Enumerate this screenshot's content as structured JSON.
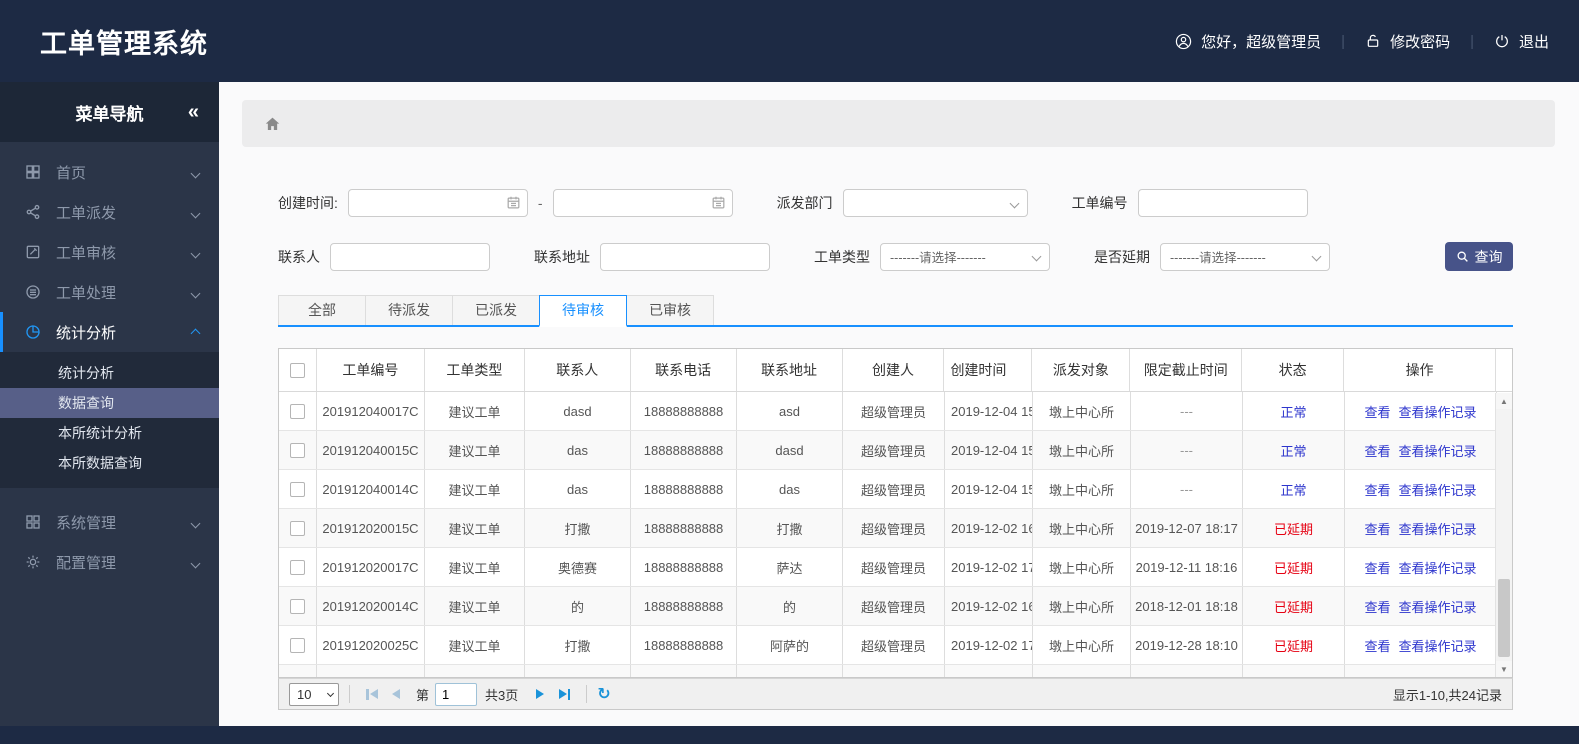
{
  "app": {
    "title": "工单管理系统"
  },
  "topbar": {
    "greeting": "您好，超级管理员",
    "change_password": "修改密码",
    "logout": "退出",
    "separator": "|"
  },
  "sidebar": {
    "title": "菜单导航",
    "collapse_glyph": "«",
    "items": [
      {
        "label": "首页",
        "icon": "grid-icon"
      },
      {
        "label": "工单派发",
        "icon": "share-icon"
      },
      {
        "label": "工单审核",
        "icon": "edit-icon"
      },
      {
        "label": "工单处理",
        "icon": "process-icon"
      },
      {
        "label": "统计分析",
        "icon": "pie-chart-icon"
      },
      {
        "label": "系统管理",
        "icon": "system-icon"
      },
      {
        "label": "配置管理",
        "icon": "gear-icon"
      }
    ],
    "submenu": [
      {
        "label": "统计分析"
      },
      {
        "label": "数据查询"
      },
      {
        "label": "本所统计分析"
      },
      {
        "label": "本所数据查询"
      }
    ],
    "active_item": "统计分析",
    "selected_submenu": "数据查询"
  },
  "filters": {
    "created_time_label": "创建时间:",
    "range_separator": "-",
    "dispatch_dept_label": "派发部门",
    "order_no_label": "工单编号",
    "contact_label": "联系人",
    "address_label": "联系地址",
    "order_type_label": "工单类型",
    "delay_label": "是否延期",
    "select_placeholder": "-------请选择-------",
    "search_button": "查询"
  },
  "tabs": [
    {
      "label": "全部"
    },
    {
      "label": "待派发"
    },
    {
      "label": "已派发"
    },
    {
      "label": "待审核"
    },
    {
      "label": "已审核"
    }
  ],
  "active_tab": "待审核",
  "table": {
    "columns": [
      "工单编号",
      "工单类型",
      "联系人",
      "联系电话",
      "联系地址",
      "创建人",
      "创建时间",
      "派发对象",
      "限定截止时间",
      "状态",
      "操作"
    ],
    "actions": {
      "view": "查看",
      "view_log": "查看操作记录"
    },
    "rows": [
      {
        "order_no": "201912040017C",
        "type": "建议工单",
        "contact": "dasd",
        "phone": "18888888888",
        "address": "asd",
        "creator": "超级管理员",
        "created": "2019-12-04 15",
        "target": "墩上中心所",
        "deadline": "---",
        "status": "正常",
        "status_class": "st-normal"
      },
      {
        "order_no": "201912040015C",
        "type": "建议工单",
        "contact": "das",
        "phone": "18888888888",
        "address": "dasd",
        "creator": "超级管理员",
        "created": "2019-12-04 15",
        "target": "墩上中心所",
        "deadline": "---",
        "status": "正常",
        "status_class": "st-normal"
      },
      {
        "order_no": "201912040014C",
        "type": "建议工单",
        "contact": "das",
        "phone": "18888888888",
        "address": "das",
        "creator": "超级管理员",
        "created": "2019-12-04 15",
        "target": "墩上中心所",
        "deadline": "---",
        "status": "正常",
        "status_class": "st-normal"
      },
      {
        "order_no": "201912020015C",
        "type": "建议工单",
        "contact": "打撒",
        "phone": "18888888888",
        "address": "打撒",
        "creator": "超级管理员",
        "created": "2019-12-02 16",
        "target": "墩上中心所",
        "deadline": "2019-12-07 18:17",
        "status": "已延期",
        "status_class": "st-delayed"
      },
      {
        "order_no": "201912020017C",
        "type": "建议工单",
        "contact": "奥德赛",
        "phone": "18888888888",
        "address": "萨达",
        "creator": "超级管理员",
        "created": "2019-12-02 17",
        "target": "墩上中心所",
        "deadline": "2019-12-11 18:16",
        "status": "已延期",
        "status_class": "st-delayed"
      },
      {
        "order_no": "201912020014C",
        "type": "建议工单",
        "contact": "的",
        "phone": "18888888888",
        "address": "的",
        "creator": "超级管理员",
        "created": "2019-12-02 16",
        "target": "墩上中心所",
        "deadline": "2018-12-01 18:18",
        "status": "已延期",
        "status_class": "st-delayed"
      },
      {
        "order_no": "201912020025C",
        "type": "建议工单",
        "contact": "打撒",
        "phone": "18888888888",
        "address": "阿萨的",
        "creator": "超级管理员",
        "created": "2019-12-02 17",
        "target": "墩上中心所",
        "deadline": "2019-12-28 18:10",
        "status": "已延期",
        "status_class": "st-delayed"
      }
    ]
  },
  "pagination": {
    "page_size": "10",
    "page_label_prefix": "第",
    "current_page": "1",
    "total_pages_label": "共3页",
    "summary": "显示1-10,共24记录"
  },
  "icons": {
    "collapse": "«",
    "scroll_up": "▲",
    "scroll_down": "▼",
    "refresh": "↻"
  },
  "colors": {
    "header_bg": "#1d2a44",
    "accent_blue": "#1890ff",
    "link_blue": "#2d35cd",
    "status_normal": "#2d35cd",
    "status_delayed": "#e60012",
    "query_button": "#475389",
    "submenu_selected": "#575f88"
  }
}
